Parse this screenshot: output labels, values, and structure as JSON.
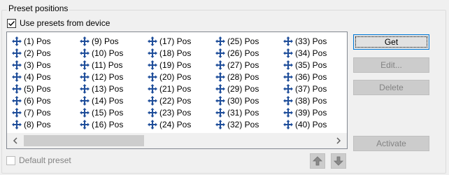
{
  "group": {
    "title": "Preset positions",
    "use_presets_label": "Use presets from device",
    "use_presets_checked": true,
    "default_preset_label": "Default preset",
    "default_preset_checked": false
  },
  "list": {
    "icon": "move-arrows-icon",
    "columns": [
      [
        "(1) Pos",
        "(2) Pos",
        "(3) Pos",
        "(4) Pos",
        "(5) Pos",
        "(6) Pos",
        "(7) Pos",
        "(8) Pos"
      ],
      [
        "(9) Pos",
        "(10) Pos",
        "(11) Pos",
        "(12) Pos",
        "(13) Pos",
        "(14) Pos",
        "(15) Pos",
        "(16) Pos"
      ],
      [
        "(17) Pos",
        "(18) Pos",
        "(19) Pos",
        "(20) Pos",
        "(21) Pos",
        "(22) Pos",
        "(23) Pos",
        "(24) Pos"
      ],
      [
        "(25) Pos",
        "(26) Pos",
        "(27) Pos",
        "(28) Pos",
        "(29) Pos",
        "(30) Pos",
        "(31) Pos",
        "(32) Pos"
      ],
      [
        "(33) Pos",
        "(34) Pos",
        "(35) Pos",
        "(36) Pos",
        "(37) Pos",
        "(38) Pos",
        "(39) Pos",
        "(40) Pos"
      ]
    ]
  },
  "buttons": {
    "get": "Get",
    "edit": "Edit...",
    "delete": "Delete",
    "activate": "Activate"
  },
  "colors": {
    "icon_blue": "#1f4e9a",
    "focus_border": "#0078d7"
  }
}
